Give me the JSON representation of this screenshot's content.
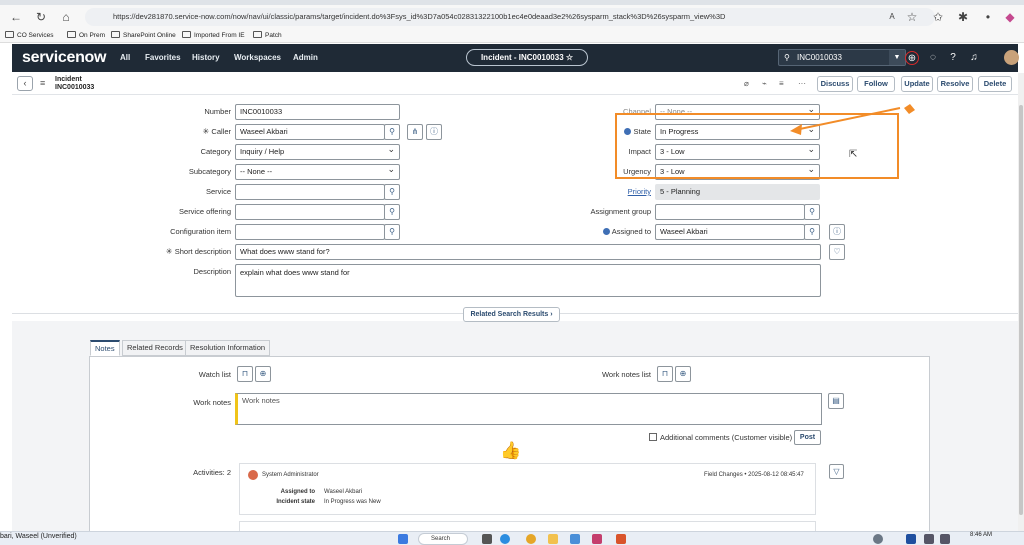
{
  "browser": {
    "url": "https://dev281870.service-now.com/now/nav/ui/classic/params/target/incident.do%3Fsys_id%3D7a054c02831322100b1ec4e0deaad3e2%26sysparm_stack%3D%26sysparm_view%3D",
    "bookmarks": [
      "CO Services",
      "On Prem",
      "SharePoint Online",
      "Imported From IE",
      "Patch"
    ]
  },
  "header": {
    "logo": "servicenow",
    "nav": [
      "All",
      "Favorites",
      "History",
      "Workspaces",
      "Admin"
    ],
    "record_pill": "Incident - INC0010033 ☆",
    "search_value": "INC0010033"
  },
  "record_header": {
    "type": "Incident",
    "number": "INC0010033",
    "buttons": [
      "Discuss",
      "Follow",
      "Update",
      "Resolve",
      "Delete"
    ]
  },
  "form": {
    "number_label": "Number",
    "number_value": "INC0010033",
    "caller_label": "Caller",
    "caller_value": "Waseel Akbari",
    "category_label": "Category",
    "category_value": "Inquiry / Help",
    "subcategory_label": "Subcategory",
    "subcategory_value": "-- None --",
    "service_label": "Service",
    "service_value": "",
    "offering_label": "Service offering",
    "offering_value": "",
    "ci_label": "Configuration item",
    "ci_value": "",
    "short_desc_label": "Short description",
    "short_desc_value": "What does www stand for?",
    "desc_label": "Description",
    "desc_value": "explain what does www stand for",
    "channel_label": "Channel",
    "channel_value": "-- None --",
    "state_label": "State",
    "state_value": "In Progress",
    "impact_label": "Impact",
    "impact_value": "3 - Low",
    "urgency_label": "Urgency",
    "urgency_value": "3 - Low",
    "priority_label": "Priority",
    "priority_value": "5 - Planning",
    "assign_group_label": "Assignment group",
    "assign_group_value": "",
    "assigned_to_label": "Assigned to",
    "assigned_to_value": "Waseel Akbari"
  },
  "related_search": "Related Search Results",
  "tabs": [
    "Notes",
    "Related Records",
    "Resolution Information"
  ],
  "notes": {
    "watch_list_label": "Watch list",
    "work_notes_list_label": "Work notes list",
    "work_notes_label": "Work notes",
    "work_notes_placeholder": "Work notes",
    "additional_comments": "Additional comments (Customer visible)",
    "post": "Post",
    "activities_label": "Activities: 2"
  },
  "activity": {
    "user": "System Administrator",
    "meta": "Field Changes  •  2025-08-12 08:45:47",
    "assigned_to_label": "Assigned to",
    "assigned_to_value": "Waseel Akbari",
    "state_label": "Incident state",
    "state_value": "In Progress  was  New"
  },
  "taskbar": {
    "user": "bari, Waseel (Unverified)",
    "search": "Search",
    "time": "8:46 AM"
  }
}
